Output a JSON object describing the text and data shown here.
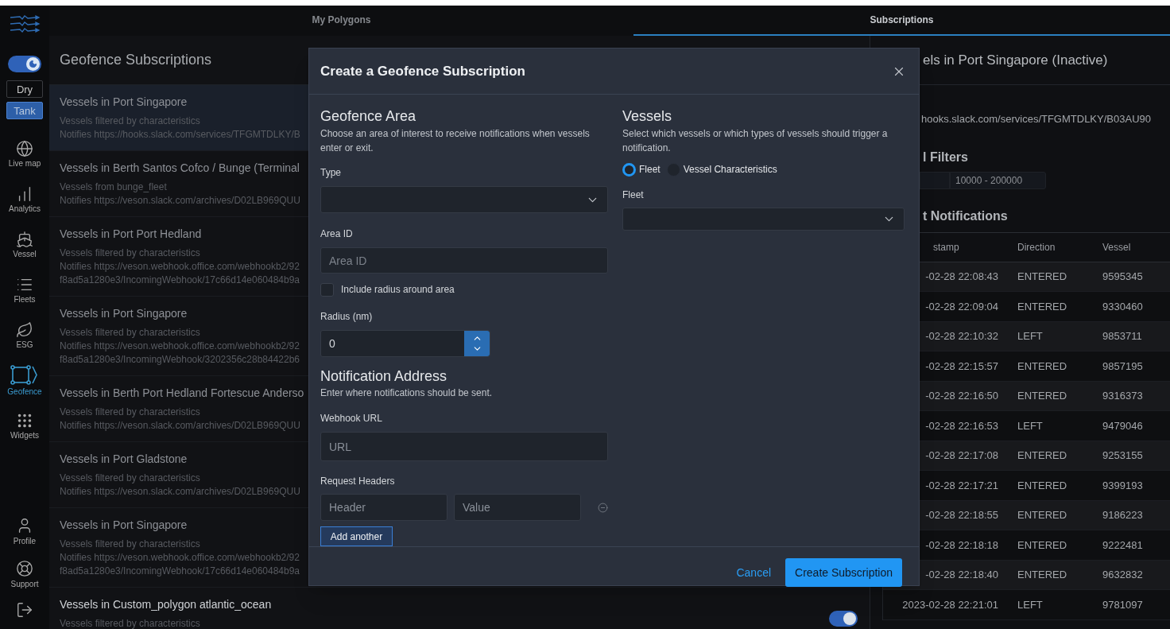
{
  "sidebar": {
    "theme_toggle": {
      "on": true
    },
    "modes": [
      {
        "label": "Dry",
        "selected": false
      },
      {
        "label": "Tank",
        "selected": true
      }
    ],
    "nav": [
      {
        "label": "Live map",
        "selected": false
      },
      {
        "label": "Analytics",
        "selected": false
      },
      {
        "label": "Vessel",
        "selected": false
      },
      {
        "label": "Fleets",
        "selected": false
      },
      {
        "label": "ESG",
        "selected": false
      },
      {
        "label": "Geofence",
        "selected": true
      },
      {
        "label": "Widgets",
        "selected": false
      }
    ],
    "bottom_nav": [
      {
        "label": "Profile"
      },
      {
        "label": "Support"
      }
    ]
  },
  "tabs": [
    {
      "label": "My Polygons",
      "selected": false
    },
    {
      "label": "Subscriptions",
      "selected": true
    }
  ],
  "subscriptions_panel": {
    "title": "Geofence Subscriptions",
    "items": [
      {
        "title": "Vessels in Port Singapore",
        "lines": [
          "Vessels filtered by characteristics",
          "Notifies https://hooks.slack.com/services/TFGMTDLKY/B"
        ],
        "selected": true
      },
      {
        "title": "Vessels in Berth Santos Cofco / Bunge (Terminal",
        "lines": [
          "Vessels from bunge_fleet",
          "Notifies https://veson.slack.com/archives/D02LB969QUU"
        ],
        "selected": false
      },
      {
        "title": "Vessels in Port Port Hedland",
        "lines": [
          "Vessels filtered by characteristics",
          "Notifies https://veson.webhook.office.com/webhookb2/92",
          "f8ad5a1280e3/IncomingWebhook/17c66d14e060484b9a"
        ],
        "selected": false
      },
      {
        "title": "Vessels in Port Singapore",
        "lines": [
          "Vessels filtered by characteristics",
          "Notifies https://veson.webhook.office.com/webhookb2/92",
          "f8ad5a1280e3/IncomingWebhook/3202356c28b84422b6"
        ],
        "selected": false
      },
      {
        "title": "Vessels in Berth Port Hedland Fortescue Anderso",
        "lines": [
          "Vessels filtered by characteristics",
          "Notifies https://veson.slack.com/archives/D02LB969QUU"
        ],
        "selected": false
      },
      {
        "title": "Vessels in Port Gladstone",
        "lines": [
          "Vessels filtered by characteristics",
          "Notifies https://veson.slack.com/archives/D02LB969QUU"
        ],
        "selected": false
      },
      {
        "title": "Vessels in Port Singapore",
        "lines": [
          "Vessels filtered by characteristics",
          "Notifies https://veson.webhook.office.com/webhookb2/92",
          "f8ad5a1280e3/IncomingWebhook/17c66d14e060484b9a"
        ],
        "selected": false
      },
      {
        "title": "Vessels in Custom_polygon atlantic_ocean",
        "lines": [
          "Vessels filtered by characteristics"
        ],
        "selected": false,
        "active": true
      }
    ]
  },
  "detail_panel": {
    "title": "els in Port Singapore (Inactive)",
    "webhook": "hooks.slack.com/services/TFGMTDLKY/B03AU90",
    "filters_heading": "l Filters",
    "filter_value": "10000 - 200000",
    "notifications_heading": "t Notifications",
    "table": {
      "columns": [
        "stamp",
        "Direction",
        "Vessel"
      ],
      "rows": [
        [
          "-02-28 22:08:43",
          "ENTERED",
          "9595345"
        ],
        [
          "-02-28 22:09:04",
          "ENTERED",
          "9330460"
        ],
        [
          "-02-28 22:10:32",
          "LEFT",
          "9853711"
        ],
        [
          "-02-28 22:15:57",
          "ENTERED",
          "9857195"
        ],
        [
          "-02-28 22:16:50",
          "ENTERED",
          "9316373"
        ],
        [
          "-02-28 22:16:53",
          "LEFT",
          "9479046"
        ],
        [
          "-02-28 22:17:08",
          "ENTERED",
          "9253155"
        ],
        [
          "-02-28 22:17:21",
          "ENTERED",
          "9399193"
        ],
        [
          "-02-28 22:18:55",
          "ENTERED",
          "9186223"
        ],
        [
          "-02-28 22:18:18",
          "ENTERED",
          "9222481"
        ],
        [
          "-02-28 22:18:40",
          "ENTERED",
          "9632832"
        ],
        [
          "2023-02-28 22:21:01",
          "LEFT",
          "9781097"
        ]
      ]
    }
  },
  "dialog": {
    "title": "Create a Geofence Subscription",
    "area": {
      "heading": "Geofence Area",
      "description": "Choose an area of interest to receive notifications when vessels enter or exit.",
      "type_label": "Type",
      "area_id_label": "Area ID",
      "area_id_placeholder": "Area ID",
      "include_radius": {
        "label": "Include radius around area",
        "checked": false
      },
      "radius_label": "Radius (nm)",
      "radius_value": "0"
    },
    "notification": {
      "heading": "Notification Address",
      "description": "Enter where notifications should be sent.",
      "webhook_label": "Webhook URL",
      "webhook_placeholder": "URL",
      "headers_label": "Request Headers",
      "header_placeholder": "Header",
      "value_placeholder": "Value",
      "add_button": "Add another"
    },
    "vessels": {
      "heading": "Vessels",
      "description": "Select which vessels or which types of vessels should trigger a notification.",
      "options": [
        {
          "label": "Fleet",
          "selected": true
        },
        {
          "label": "Vessel Characteristics",
          "selected": false
        }
      ],
      "fleet_label": "Fleet"
    },
    "buttons": {
      "cancel": "Cancel",
      "submit": "Create Subscription"
    }
  }
}
